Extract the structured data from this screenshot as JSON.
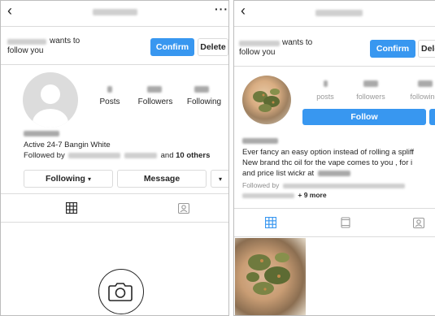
{
  "left_screen": {
    "request": {
      "text_suffix": "wants to",
      "text_line2": "follow you",
      "confirm_label": "Confirm",
      "delete_label": "Delete"
    },
    "stats": {
      "posts_label": "Posts",
      "followers_label": "Followers",
      "following_label": "Following"
    },
    "bio": {
      "line1": "Active 24-7 Bangin White",
      "followed_prefix": "Followed by",
      "followed_suffix_and": "and",
      "followed_suffix_count": "10 others"
    },
    "actions": {
      "following_label": "Following",
      "message_label": "Message"
    },
    "icons": {
      "back": "chevron-left-icon",
      "more": "more-dots-icon",
      "grid": "grid-icon",
      "tagged": "tagged-person-icon",
      "camera": "camera-icon"
    }
  },
  "right_screen": {
    "request": {
      "text_suffix": "wants to",
      "text_line2": "follow you",
      "confirm_label": "Confirm",
      "delete_label": "Delete"
    },
    "stats": {
      "posts_label": "posts",
      "followers_label": "followers",
      "following_label": "following"
    },
    "follow_label": "Follow",
    "bio": {
      "line1": "Ever fancy an easy option instead of rolling a spliff",
      "line2": "New brand thc oil for the vape comes to you , for i",
      "line3": "and price list wickr at",
      "followed_prefix": "Followed by",
      "more_text": "+ 9 more"
    },
    "icons": {
      "back": "chevron-left-icon",
      "grid": "grid-icon",
      "igtv": "igtv-icon",
      "tagged": "tagged-person-icon"
    }
  },
  "colors": {
    "accent_blue": "#3897f0",
    "border": "#dbdbdb",
    "text": "#262626",
    "muted": "#8e8e8e"
  }
}
